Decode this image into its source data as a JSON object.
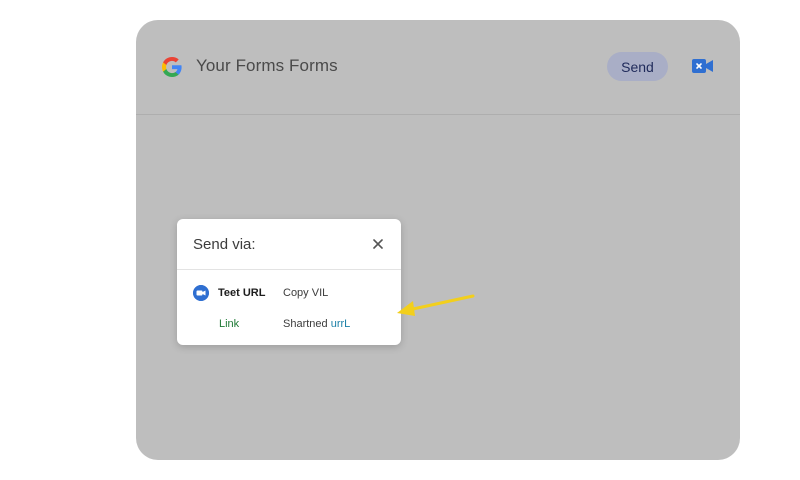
{
  "header": {
    "title": "Your Forms Forms",
    "send_label": "Send",
    "logo_icon": "google-g-icon",
    "video_icon": "meet-video-icon"
  },
  "dialog": {
    "title": "Send via:",
    "close_icon": "close-icon",
    "option": {
      "icon": "video-camera-icon",
      "name": "Teet URL",
      "action": "Copy VIL"
    },
    "link": {
      "label": "Link",
      "short_prefix": "Shartned ",
      "short_accent": "urrL"
    }
  },
  "colors": {
    "backdrop": "#bebebe",
    "send_button": "#a9aec6",
    "accent_blue": "#2f6fd1",
    "link_green": "#1f7a36",
    "arrow_yellow": "#f2cf1c"
  }
}
